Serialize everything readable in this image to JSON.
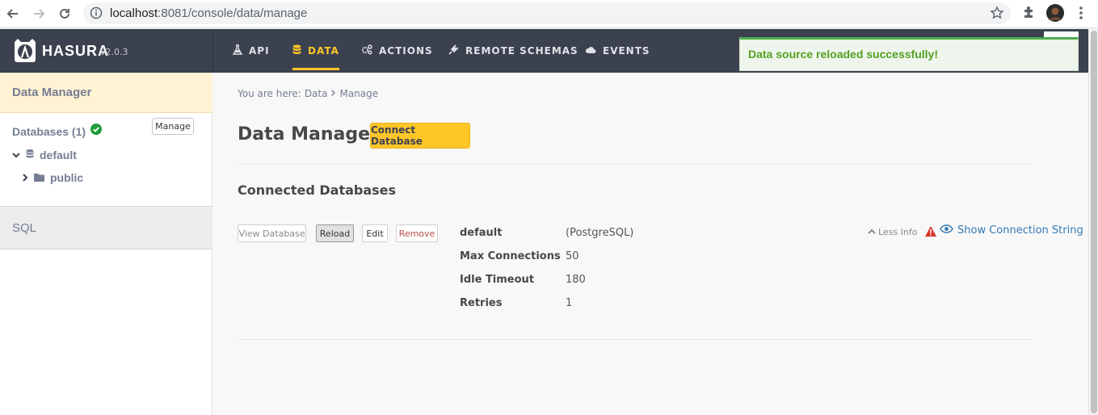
{
  "browser": {
    "url_host": "localhost",
    "url_rest": ":8081/console/data/manage"
  },
  "brand": {
    "name": "HASURA",
    "version": "v2.0.3"
  },
  "topnav": {
    "items": [
      {
        "label": "API",
        "icon": "flask-icon"
      },
      {
        "label": "DATA",
        "icon": "database-icon",
        "active": true
      },
      {
        "label": "ACTIONS",
        "icon": "cogs-icon"
      },
      {
        "label": "REMOTE SCHEMAS",
        "icon": "plug-icon"
      },
      {
        "label": "EVENTS",
        "icon": "cloud-icon"
      }
    ]
  },
  "toast": {
    "message": "Data source reloaded successfully!",
    "color": "#54a020"
  },
  "sidebar": {
    "header": "Data Manager",
    "databases_label": "Databases (1)",
    "manage_label": "Manage",
    "tree": [
      {
        "label": "default"
      },
      {
        "label": "public"
      }
    ],
    "sql_label": "SQL"
  },
  "main": {
    "breadcrumb": {
      "prefix": "You are here:",
      "items": [
        "Data",
        "Manage"
      ]
    },
    "title": "Data Manager",
    "connect_label": "Connect Database",
    "section_title": "Connected Databases",
    "db_actions": {
      "view": "View Database",
      "reload": "Reload",
      "edit": "Edit",
      "remove": "Remove"
    },
    "db_info": [
      {
        "key": "default",
        "value": "(PostgreSQL)"
      },
      {
        "key": "Max Connections",
        "value": "50"
      },
      {
        "key": "Idle Timeout",
        "value": "180"
      },
      {
        "key": "Retries",
        "value": "1"
      }
    ],
    "less_info_label": "Less Info",
    "show_connection_label": "Show Connection String"
  },
  "colors": {
    "accent": "#ffc627",
    "nav_bg": "#3c4150",
    "link": "#337ab7"
  }
}
